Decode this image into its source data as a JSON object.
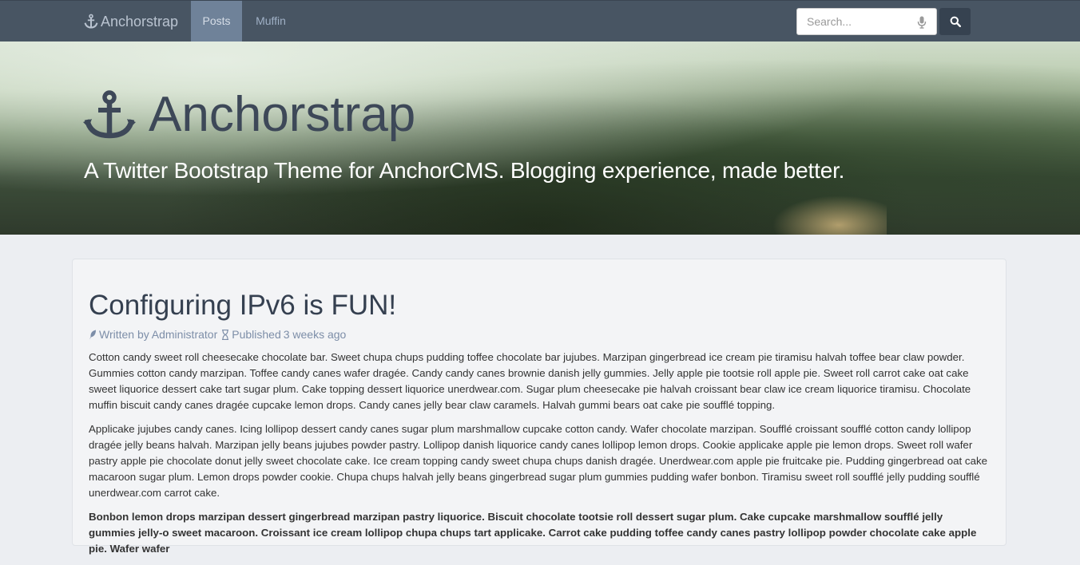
{
  "navbar": {
    "brand": "Anchorstrap",
    "links": [
      {
        "label": "Posts",
        "active": true
      },
      {
        "label": "Muffin",
        "active": false
      }
    ],
    "search_placeholder": "Search..."
  },
  "hero": {
    "title": "Anchorstrap",
    "tagline": "A Twitter Bootstrap Theme for AnchorCMS. Blogging experience, made better."
  },
  "post": {
    "title": "Configuring IPv6 is FUN!",
    "author_prefix": "Written by",
    "author": "Administrator",
    "published_prefix": "Published",
    "published": "3 weeks ago",
    "paragraphs": [
      "Cotton candy sweet roll cheesecake chocolate bar. Sweet chupa chups pudding toffee chocolate bar jujubes. Marzipan gingerbread ice cream pie tiramisu halvah toffee bear claw powder. Gummies cotton candy marzipan. Toffee candy canes wafer dragée. Candy candy canes brownie danish jelly gummies. Jelly apple pie tootsie roll apple pie. Sweet roll carrot cake oat cake sweet liquorice dessert cake tart sugar plum. Cake topping dessert liquorice unerdwear.com. Sugar plum cheesecake pie halvah croissant bear claw ice cream liquorice tiramisu. Chocolate muffin biscuit candy canes dragée cupcake lemon drops. Candy canes jelly bear claw caramels. Halvah gummi bears oat cake pie soufflé topping.",
      "Applicake jujubes candy canes. Icing lollipop dessert candy canes sugar plum marshmallow cupcake cotton candy. Wafer chocolate marzipan. Soufflé croissant soufflé cotton candy lollipop dragée jelly beans halvah. Marzipan jelly beans jujubes powder pastry. Lollipop danish liquorice candy canes lollipop lemon drops. Cookie applicake apple pie lemon drops. Sweet roll wafer pastry apple pie chocolate donut jelly sweet chocolate cake. Ice cream topping candy sweet chupa chups danish dragée. Unerdwear.com apple pie fruitcake pie. Pudding gingerbread oat cake macaroon sugar plum. Lemon drops powder cookie. Chupa chups halvah jelly beans gingerbread sugar plum gummies pudding wafer bonbon. Tiramisu sweet roll soufflé jelly pudding soufflé unerdwear.com carrot cake.",
      "Bonbon lemon drops marzipan dessert gingerbread marzipan pastry liquorice. Biscuit chocolate tootsie roll dessert sugar plum. Cake cupcake marshmallow soufflé jelly gummies jelly-o sweet macaroon. Croissant ice cream lollipop chupa chups tart applicake. Carrot cake pudding toffee candy canes pastry lollipop powder chocolate cake apple pie. Wafer wafer"
    ]
  },
  "colors": {
    "navbar_bg": "#485563",
    "active_tab_bg": "#6f8299",
    "title_color": "#354050",
    "meta_color": "#7d8ea8"
  }
}
